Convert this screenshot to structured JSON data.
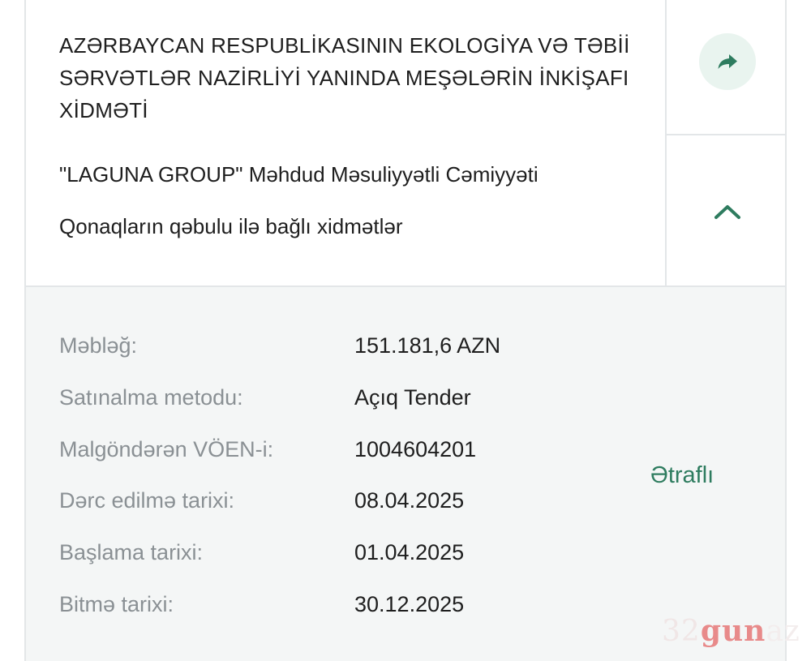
{
  "tender": {
    "organization": "AZƏRBAYCAN RESPUBLİKASININ EKOLOGİYA VƏ TƏBİİ SƏRVƏTLƏR NAZİRLİYİ YANINDA MEŞƏLƏRİN İNKİŞAFI XİDMƏTİ",
    "company": "\"LAGUNA GROUP\" Məhdud Məsuliyyətli Cəmiyyəti",
    "service": "Qonaqların qəbulu ilə bağlı xidmətlər"
  },
  "actions": {
    "share_icon": "share-arrow-icon",
    "collapse_icon": "chevron-up-icon"
  },
  "details": {
    "rows": [
      {
        "label": "Məbləğ:",
        "value": "151.181,6 AZN"
      },
      {
        "label": "Satınalma metodu:",
        "value": "Açıq Tender"
      },
      {
        "label": "Malgöndərən VÖEN-i:",
        "value": "1004604201"
      },
      {
        "label": "Dərc edilmə tarixi:",
        "value": "08.04.2025"
      },
      {
        "label": "Başlama tarixi:",
        "value": "01.04.2025"
      },
      {
        "label": "Bitmə tarixi:",
        "value": "30.12.2025"
      }
    ],
    "more_link": "Ətraflı"
  },
  "watermark": {
    "number": "32",
    "word": "gun",
    "tail": "az"
  },
  "colors": {
    "accent": "#2e7c5f",
    "share_bg": "#e9f4ef",
    "details_bg": "#f4f6f6",
    "label": "#8a9094"
  }
}
